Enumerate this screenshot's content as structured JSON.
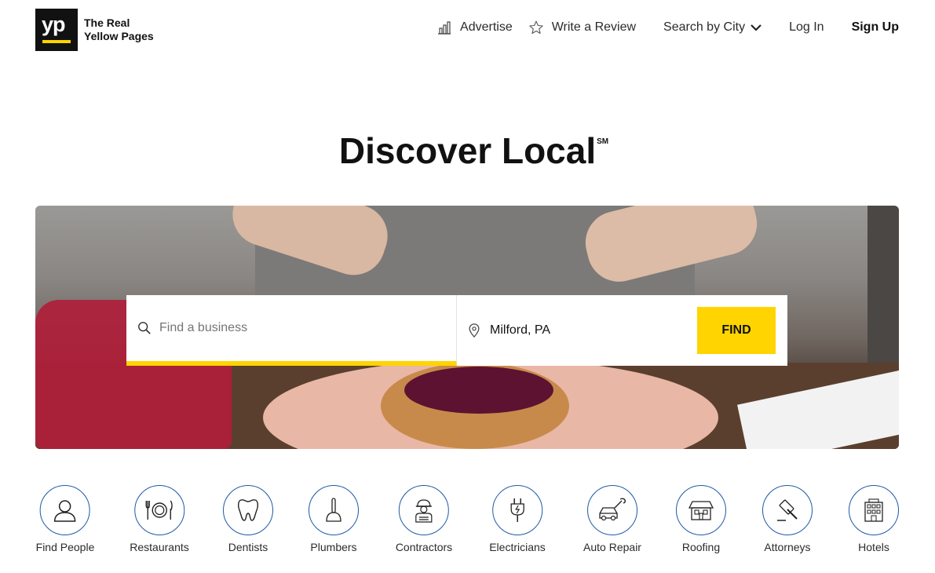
{
  "header": {
    "logo_mark": "yp",
    "logo_line1": "The Real",
    "logo_line2": "Yellow Pages",
    "nav": {
      "advertise": "Advertise",
      "write_review": "Write a Review",
      "search_city": "Search by City",
      "log_in": "Log In",
      "sign_up": "Sign Up"
    }
  },
  "title": {
    "text": "Discover Local",
    "mark": "SM"
  },
  "search": {
    "what_placeholder": "Find a business",
    "where_value": "Milford, PA",
    "find_label": "FIND"
  },
  "categories": [
    {
      "label": "Find People",
      "icon": "person-icon"
    },
    {
      "label": "Restaurants",
      "icon": "plate-utensils-icon"
    },
    {
      "label": "Dentists",
      "icon": "tooth-icon"
    },
    {
      "label": "Plumbers",
      "icon": "plunger-icon"
    },
    {
      "label": "Contractors",
      "icon": "worker-icon"
    },
    {
      "label": "Electricians",
      "icon": "plug-icon"
    },
    {
      "label": "Auto Repair",
      "icon": "car-wrench-icon"
    },
    {
      "label": "Roofing",
      "icon": "house-icon"
    },
    {
      "label": "Attorneys",
      "icon": "gavel-icon"
    },
    {
      "label": "Hotels",
      "icon": "hotel-icon"
    }
  ],
  "colors": {
    "accent_yellow": "#ffd400",
    "icon_blue": "#1f5aa6",
    "text": "#2b2b2b"
  }
}
